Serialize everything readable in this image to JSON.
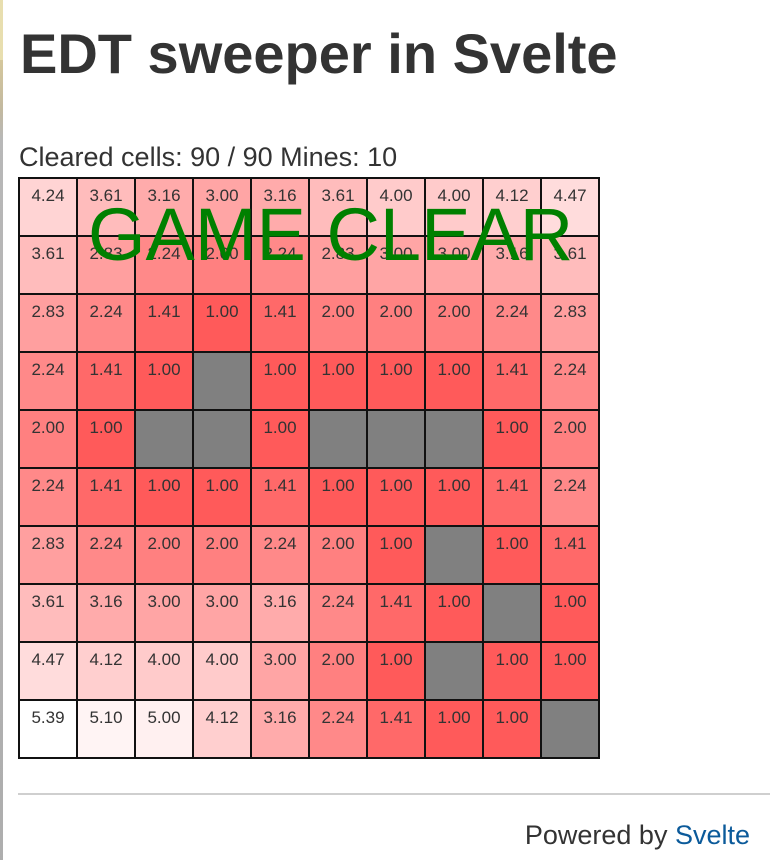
{
  "app": {
    "title": "EDT sweeper in Svelte"
  },
  "status": {
    "text": "Cleared cells: 90 / 90 Mines: 10"
  },
  "overlay": {
    "text": "GAME CLEAR"
  },
  "colors": {
    "overlay_text": "#008000",
    "mine_cell": "#808080",
    "cell_red_max": "#ff5a5a",
    "link": "#0b5a9a"
  },
  "board": {
    "rows": [
      [
        "4.24",
        "3.61",
        "3.16",
        "3.00",
        "3.16",
        "3.61",
        "4.00",
        "4.00",
        "4.12",
        "4.47"
      ],
      [
        "3.61",
        "2.83",
        "2.24",
        "2.00",
        "2.24",
        "2.83",
        "3.00",
        "3.00",
        "3.16",
        "3.61"
      ],
      [
        "2.83",
        "2.24",
        "1.41",
        "1.00",
        "1.41",
        "2.00",
        "2.00",
        "2.00",
        "2.24",
        "2.83"
      ],
      [
        "2.24",
        "1.41",
        "1.00",
        null,
        "1.00",
        "1.00",
        "1.00",
        "1.00",
        "1.41",
        "2.24"
      ],
      [
        "2.00",
        "1.00",
        null,
        null,
        "1.00",
        null,
        null,
        null,
        "1.00",
        "2.00"
      ],
      [
        "2.24",
        "1.41",
        "1.00",
        "1.00",
        "1.41",
        "1.00",
        "1.00",
        "1.00",
        "1.41",
        "2.24"
      ],
      [
        "2.83",
        "2.24",
        "2.00",
        "2.00",
        "2.24",
        "2.00",
        "1.00",
        null,
        "1.00",
        "1.41"
      ],
      [
        "3.61",
        "3.16",
        "3.00",
        "3.00",
        "3.16",
        "2.24",
        "1.41",
        "1.00",
        null,
        "1.00"
      ],
      [
        "4.47",
        "4.12",
        "4.00",
        "4.00",
        "3.00",
        "2.00",
        "1.00",
        null,
        "1.00",
        "1.00"
      ],
      [
        "5.39",
        "5.10",
        "5.00",
        "4.12",
        "3.16",
        "2.24",
        "1.41",
        "1.00",
        "1.00",
        null
      ]
    ]
  },
  "footer": {
    "prefix": "Powered by ",
    "link_label": "Svelte"
  }
}
